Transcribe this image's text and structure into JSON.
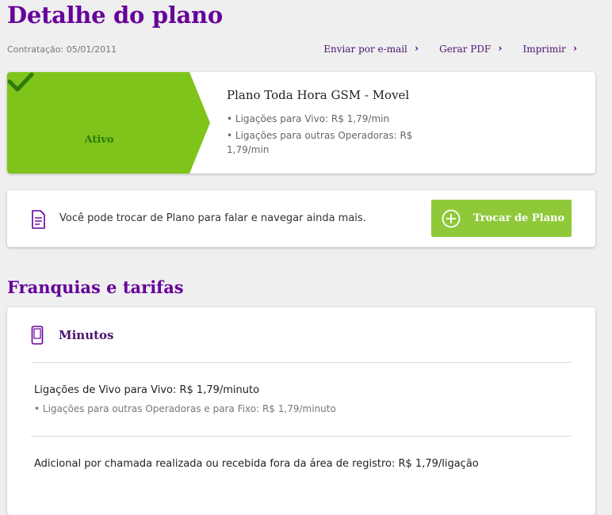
{
  "page": {
    "title": "Detalhe do plano",
    "contract_date": "Contratação: 05/01/2011"
  },
  "actions": [
    {
      "label": "Enviar por e-mail",
      "icon": "chevron-right-icon"
    },
    {
      "label": "Gerar PDF",
      "icon": "chevron-right-icon"
    },
    {
      "label": "Imprimir",
      "icon": "chevron-right-icon"
    }
  ],
  "plan": {
    "status": "Ativo",
    "status_icon": "checkmark-icon",
    "name": "Plano Toda Hora GSM - Movel",
    "features": [
      "• Ligações para Vivo: R$ 1,79/min",
      "• Ligações para outras Operadoras: R$ 1,79/min"
    ]
  },
  "change_plan": {
    "icon": "document-icon",
    "message": "Você pode trocar de Plano para falar e navegar ainda mais.",
    "button_label": "Trocar de Plano",
    "button_icon": "plus-circle-icon"
  },
  "franchises": {
    "section_title": "Franquias e tarifas",
    "card_title": "Minutos",
    "card_icon": "phone-icon",
    "main_rate": "Ligações de Vivo para Vivo: R$ 1,79/minuto",
    "sub_rate": "• Ligações para outras Operadoras e para Fixo: R$ 1,79/minuto",
    "extra_charge": "Adicional por chamada realizada ou recebida fora da área de registro: R$ 1,79/ligação"
  },
  "colors": {
    "brand_purple": "#660099",
    "status_green": "#7ec41a",
    "button_green": "#8fc93a",
    "check_green": "#2f7a0a",
    "background": "#efefef"
  }
}
